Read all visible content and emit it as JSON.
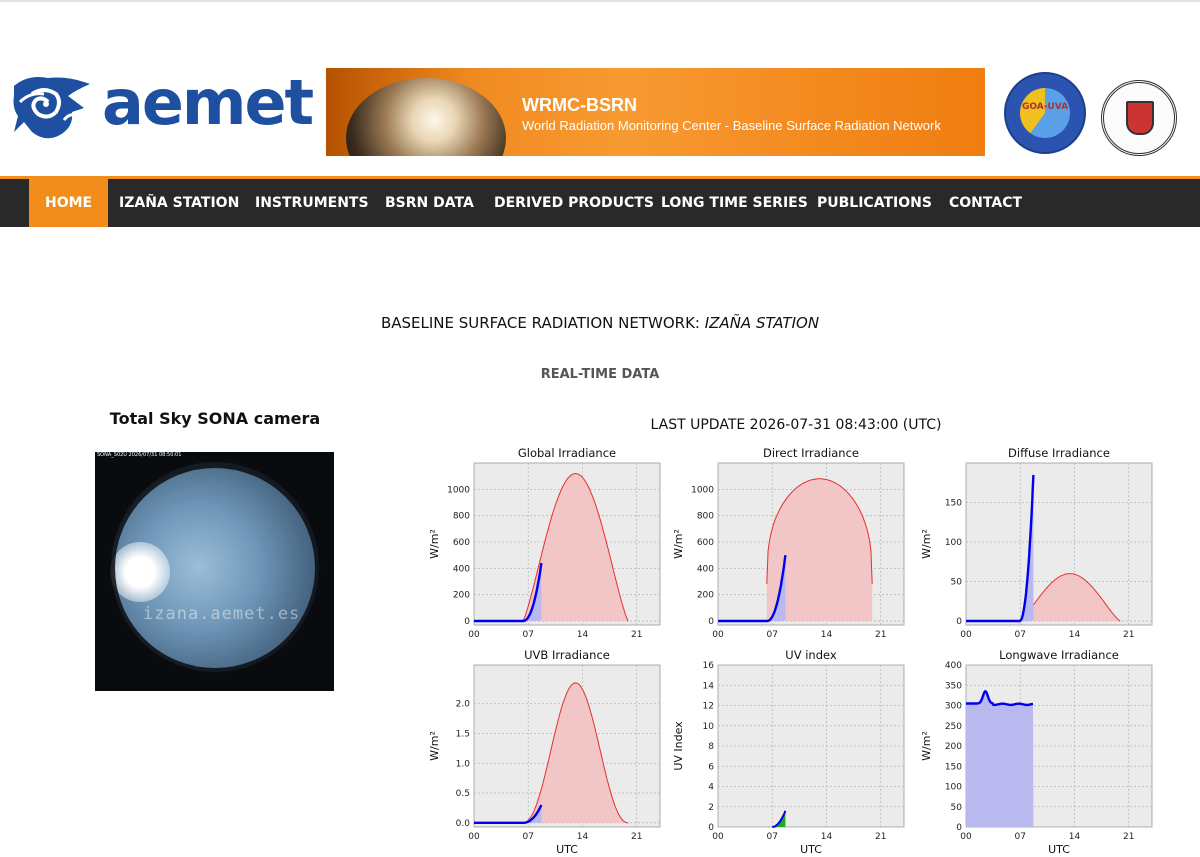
{
  "header": {
    "logo_text": "aemet",
    "banner_title": "WRMC-BSRN",
    "banner_subtitle": "World Radiation Monitoring Center - Baseline Surface Radiation Network",
    "seal_left_text": "GOA-UVA"
  },
  "nav": {
    "items": [
      {
        "label": "HOME",
        "active": true
      },
      {
        "label": "IZAÑA STATION",
        "active": false
      },
      {
        "label": "INSTRUMENTS",
        "active": false
      },
      {
        "label": "BSRN DATA",
        "active": false
      },
      {
        "label": "DERIVED PRODUCTS",
        "active": false
      },
      {
        "label": "LONG TIME SERIES",
        "active": false
      },
      {
        "label": "PUBLICATIONS",
        "active": false
      },
      {
        "label": "CONTACT",
        "active": false
      }
    ]
  },
  "page": {
    "title_main": "BASELINE SURFACE RADIATION NETWORK: ",
    "title_station": "IZAÑA STATION",
    "subtitle": "REAL-TIME DATA",
    "camera_title": "Total Sky SONA camera",
    "camera_caption": "SONA_S02U   2026/07/31 08:50:01",
    "camera_watermark": "izana.aemet.es",
    "last_update": "LAST UPDATE 2026-07-31 08:43:00 (UTC)"
  },
  "colors": {
    "nav_bg": "#292929",
    "accent": "#f28c1a",
    "plot_bg": "#ebebeb",
    "model_fill": "#f2c6c6",
    "model_line": "#e53030",
    "measured": "#0000ee",
    "measured_fill": "#b9b9ef",
    "uv_fill": "#22aa22"
  },
  "chart_data": [
    {
      "type": "area",
      "title": "Global Irradiance",
      "ylabel": "W/m²",
      "xlabel": "",
      "x_ticks": [
        "00",
        "07",
        "14",
        "21"
      ],
      "xlim": [
        0,
        24
      ],
      "ylim": [
        -30,
        1200
      ],
      "y_ticks": [
        0,
        200,
        400,
        600,
        800,
        1000
      ],
      "model": {
        "start": 6.3,
        "end": 19.9,
        "peak": 1120,
        "shape": "sine"
      },
      "measured": {
        "end": 8.7,
        "value_at_end": 440,
        "night": 0
      }
    },
    {
      "type": "area",
      "title": "Direct Irradiance",
      "ylabel": "W/m²",
      "xlabel": "",
      "x_ticks": [
        "00",
        "07",
        "14",
        "21"
      ],
      "xlim": [
        0,
        24
      ],
      "ylim": [
        -30,
        1200
      ],
      "y_ticks": [
        0,
        200,
        400,
        600,
        800,
        1000
      ],
      "model": {
        "start": 6.3,
        "end": 19.9,
        "peak": 1080,
        "shape": "dome",
        "edge": 280
      },
      "measured": {
        "end": 8.7,
        "value_at_end": 500,
        "night": 0
      }
    },
    {
      "type": "area",
      "title": "Diffuse Irradiance",
      "ylabel": "W/m²",
      "xlabel": "",
      "x_ticks": [
        "00",
        "07",
        "14",
        "21"
      ],
      "xlim": [
        0,
        24
      ],
      "ylim": [
        -5,
        200
      ],
      "y_ticks": [
        0,
        50,
        100,
        150
      ],
      "model": {
        "start": 6.9,
        "end": 19.9,
        "peak": 60,
        "shape": "sine"
      },
      "measured": {
        "end": 8.7,
        "value_at_end": 185,
        "night": 0
      }
    },
    {
      "type": "area",
      "title": "UVB Irradiance",
      "ylabel": "W/m²",
      "xlabel": "UTC",
      "x_ticks": [
        "00",
        "07",
        "14",
        "21"
      ],
      "xlim": [
        0,
        24
      ],
      "ylim": [
        -0.07,
        2.65
      ],
      "y_ticks": [
        0.0,
        0.5,
        1.0,
        1.5,
        2.0
      ],
      "y_tick_labels": [
        "0.0",
        "0.5",
        "1.0",
        "1.5",
        "2.0"
      ],
      "model": {
        "start": 6.3,
        "end": 19.9,
        "peak": 2.35,
        "shape": "sine2"
      },
      "measured": {
        "end": 8.7,
        "value_at_end": 0.3,
        "night": 0
      }
    },
    {
      "type": "area",
      "title": "UV index",
      "ylabel": "UV Index",
      "xlabel": "UTC",
      "x_ticks": [
        "00",
        "07",
        "14",
        "21"
      ],
      "xlim": [
        0,
        24
      ],
      "ylim": [
        0,
        16
      ],
      "y_ticks": [
        0,
        2,
        4,
        6,
        8,
        10,
        12,
        14,
        16
      ],
      "model": null,
      "measured": {
        "start": 7.0,
        "end": 8.7,
        "value_at_end": 1.6,
        "night": null
      }
    },
    {
      "type": "area",
      "title": "Longwave Irradiance",
      "ylabel": "W/m²",
      "xlabel": "UTC",
      "x_ticks": [
        "00",
        "07",
        "14",
        "21"
      ],
      "xlim": [
        0,
        24
      ],
      "ylim": [
        0,
        400
      ],
      "y_ticks": [
        0,
        50,
        100,
        150,
        200,
        250,
        300,
        350,
        400
      ],
      "model": null,
      "measured": {
        "end": 8.7,
        "longwave": true,
        "base": 305,
        "bump_at": 2.5,
        "bump_peak": 335,
        "value_at_end": 308
      }
    }
  ]
}
